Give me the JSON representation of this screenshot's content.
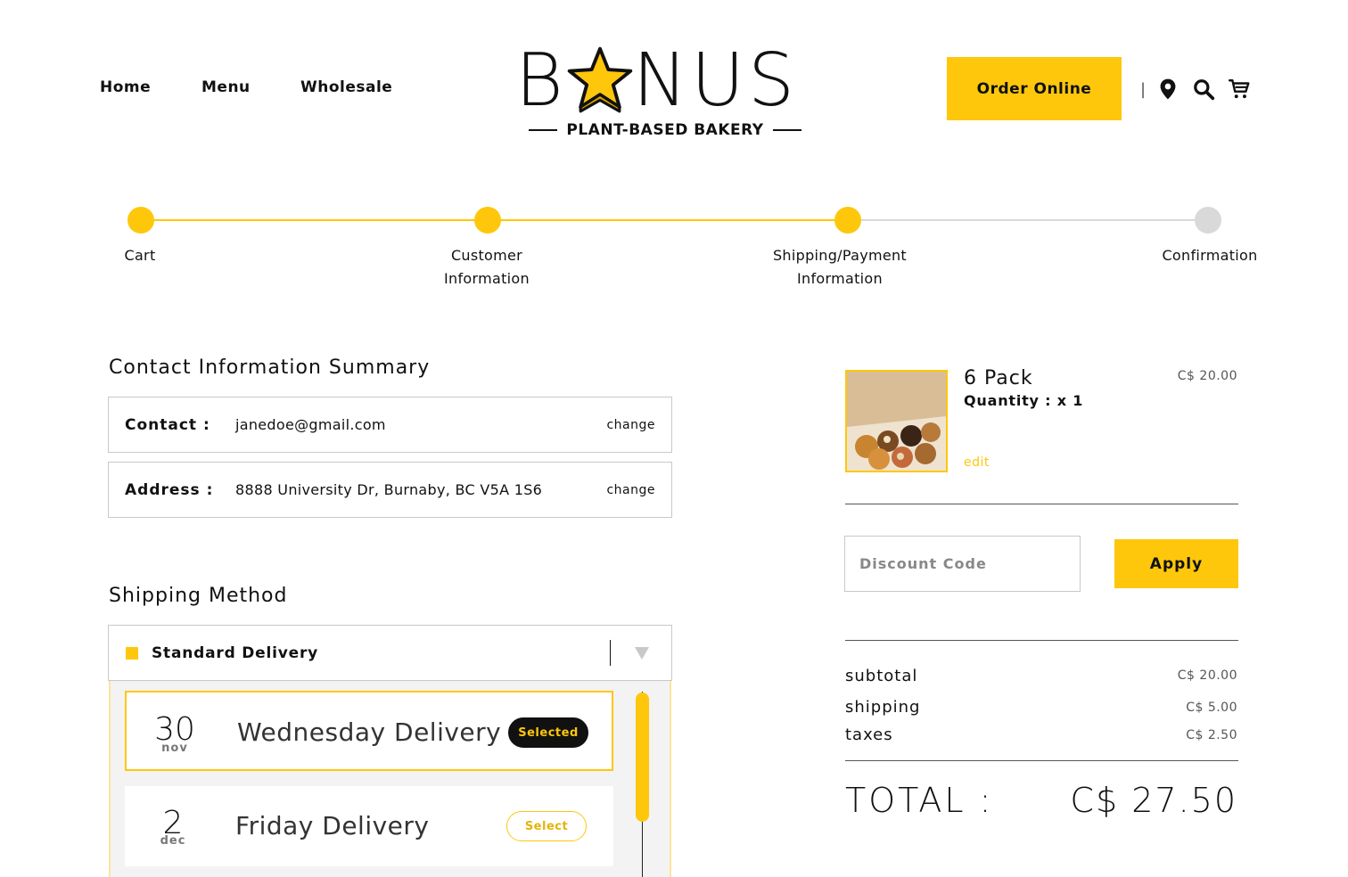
{
  "nav": {
    "items": [
      "Home",
      "Menu",
      "Wholesale"
    ]
  },
  "logo": {
    "word_left": "B",
    "word_right": "NUS",
    "tagline": "PLANT-BASED BAKERY"
  },
  "header": {
    "order_label": "Order Online",
    "separator": "|",
    "icons": [
      "location-pin-icon",
      "search-icon",
      "cart-icon"
    ]
  },
  "progress": {
    "steps": [
      {
        "label_1": "Cart",
        "label_2": "",
        "done": true
      },
      {
        "label_1": "Customer",
        "label_2": "Information",
        "done": true
      },
      {
        "label_1": "Shipping/Payment",
        "label_2": "Information",
        "done": true
      },
      {
        "label_1": "Confirmation",
        "label_2": "",
        "done": false
      }
    ]
  },
  "contact": {
    "title": "Contact Information Summary",
    "rows": [
      {
        "key": "Contact :",
        "value": "janedoe@gmail.com",
        "action": "change"
      },
      {
        "key": "Address :",
        "value": "8888 University Dr, Burnaby, BC V5A 1S6",
        "action": "change"
      }
    ]
  },
  "shipping": {
    "title": "Shipping Method",
    "selected_method": "Standard Delivery",
    "days": [
      {
        "num": "30",
        "month": "nov",
        "name": "Wednesday Delivery",
        "button": "Selected",
        "selected": true
      },
      {
        "num": "2",
        "month": "dec",
        "name": "Friday Delivery",
        "button": "Select",
        "selected": false
      }
    ]
  },
  "cart": {
    "product_name": "6 Pack",
    "quantity": "Quantity : x 1",
    "edit": "edit",
    "price": "C$ 20.00"
  },
  "discount": {
    "placeholder": "Discount Code",
    "apply_label": "Apply"
  },
  "summary": {
    "rows": [
      {
        "label": "subtotal",
        "value": "C$ 20.00"
      },
      {
        "label": "shipping",
        "value": "C$ 5.00"
      },
      {
        "label": "taxes",
        "value": "C$ 2.50"
      }
    ],
    "total_label": "TOTAL :",
    "total_value": "C$ 27.50"
  },
  "colors": {
    "accent": "#fec70c",
    "inactive": "#d9d9d9",
    "border": "#c8c8c8"
  }
}
